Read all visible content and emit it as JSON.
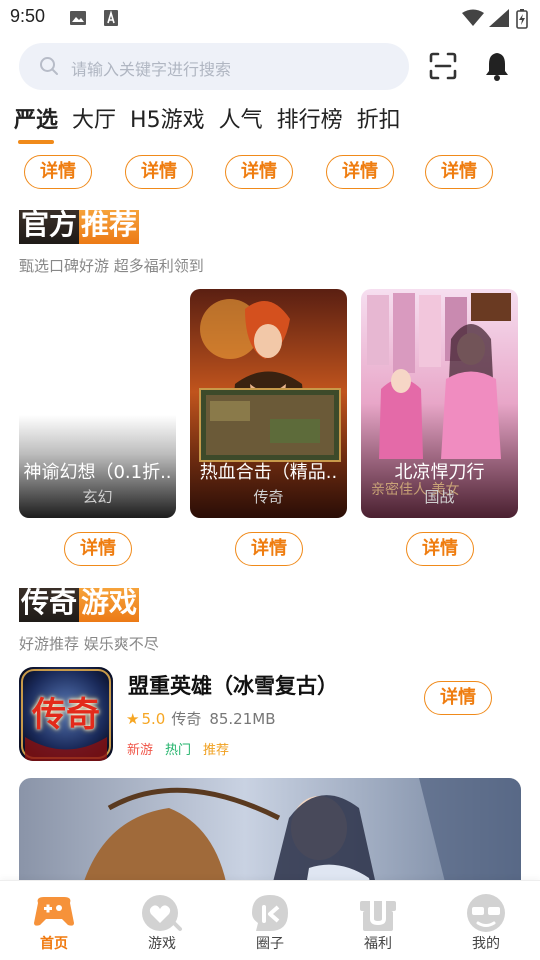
{
  "status_bar": {
    "time": "9:50"
  },
  "search": {
    "placeholder": "请输入关键字进行搜索"
  },
  "tabs": [
    {
      "label": "严选",
      "active": true
    },
    {
      "label": "大厅"
    },
    {
      "label": "H5游戏"
    },
    {
      "label": "人气"
    },
    {
      "label": "排行榜"
    },
    {
      "label": "折扣"
    }
  ],
  "top_detail_buttons": [
    "详情",
    "详情",
    "详情",
    "详情",
    "详情"
  ],
  "official_section": {
    "title_dark": "官方",
    "title_orange": "推荐",
    "subtitle": "甄选口碑好游 超多福利领到"
  },
  "official_cards": [
    {
      "name": "神谕幻想（0.1折..",
      "tag": "玄幻",
      "button": "详情"
    },
    {
      "name": "热血合击（精品..",
      "tag": "传奇",
      "button": "详情"
    },
    {
      "name": "北凉悍刀行",
      "tag": "国战",
      "button": "详情"
    }
  ],
  "legend_section": {
    "title_dark": "传奇",
    "title_orange": "游戏",
    "subtitle": "好游推荐 娱乐爽不尽"
  },
  "game_list": [
    {
      "name": "盟重英雄（冰雪复古）",
      "rating": "5.0",
      "category": "传奇",
      "size": "85.21MB",
      "tags": [
        {
          "label": "新游",
          "color": "#f0574a"
        },
        {
          "label": "热门",
          "color": "#22b36b"
        },
        {
          "label": "推荐",
          "color": "#f0a020"
        }
      ],
      "button": "详情",
      "icon_text": "传奇"
    }
  ],
  "bottom_nav": [
    {
      "label": "首页",
      "icon": "gamepad-icon",
      "active": true
    },
    {
      "label": "游戏",
      "icon": "game-heart-icon"
    },
    {
      "label": "圈子",
      "icon": "circle-chat-icon"
    },
    {
      "label": "福利",
      "icon": "gift-icon"
    },
    {
      "label": "我的",
      "icon": "profile-face-icon"
    }
  ],
  "colors": {
    "accent": "#f08a1a",
    "bg": "#ffffff",
    "search_bg": "#eef1f8"
  }
}
